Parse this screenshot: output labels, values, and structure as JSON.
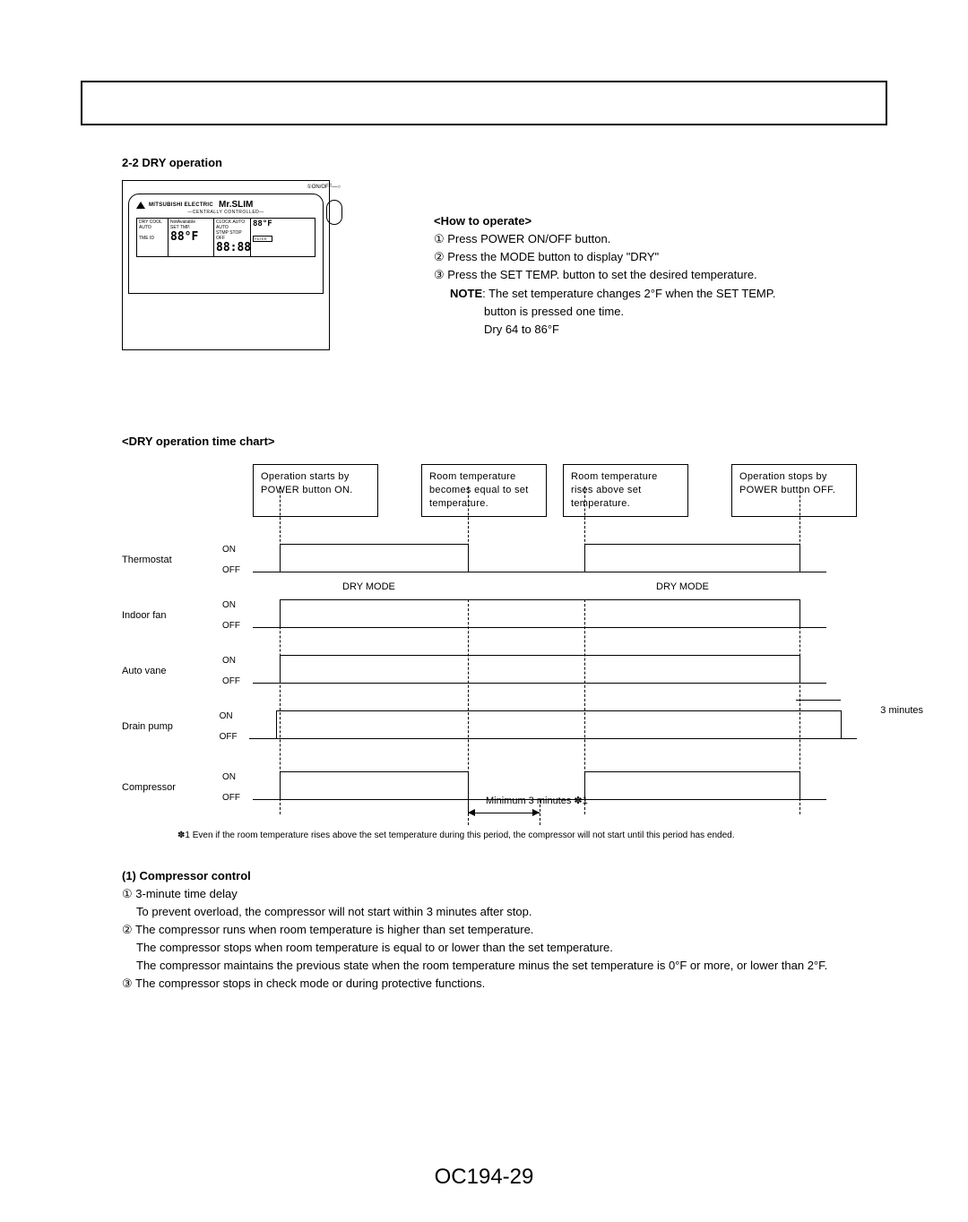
{
  "section_title": "2-2 DRY operation",
  "remote": {
    "brand_small": "MITSUBISHI ELECTRIC",
    "brand_big": "Mr.SLIM",
    "centrally": "—CENTRALLY  CONTROLLED—",
    "col1_l1": "DRY  COOL",
    "col1_l2": "AUTO",
    "col1_l3": "TME ID",
    "col1_temp": "88°F",
    "col2_l1": "NotAvailable",
    "col2_l2": "SET TMP.",
    "col2_time": "88:88",
    "col3_l1": "CLOCK AUTO  AUTO",
    "col3_l2": "STMP STOP OFF",
    "right_top": "88°F",
    "onoff": "①ON/OFF—○",
    "filter": "FILTER"
  },
  "howto": {
    "title": "<How to operate>",
    "l1": "① Press POWER ON/OFF button.",
    "l2": "② Press the MODE button to display \"DRY\"",
    "l3": "③ Press the SET TEMP. button to set the desired temperature.",
    "note_label": "NOTE",
    "note_body": ": The set temperature changes 2°F when the SET TEMP.",
    "note_body2": "button is pressed one time.",
    "note_body3": "Dry 64 to 86°F"
  },
  "chart_title": "<DRY operation time chart>",
  "events": {
    "e1": "Operation starts by POWER button ON.",
    "e2": "Room temperature becomes equal to set temperature.",
    "e3": "Room temperature rises above set temperature.",
    "e4": "Operation stops by POWER button OFF."
  },
  "row_labels": {
    "r1": "Thermostat",
    "r2": "Indoor fan",
    "r3": "Auto vane",
    "r4": "Drain pump",
    "r5": "Compressor"
  },
  "on": "ON",
  "off": "OFF",
  "dry_mode": "DRY MODE",
  "min3": "Minimum 3 minutes ✽1",
  "tag3min": "3 minutes",
  "footnote": "✽1 Even if the room temperature rises above the set temperature during this period, the compressor will not start until this period has ended.",
  "compressor": {
    "title": "(1) Compressor control",
    "l1": "① 3-minute time delay",
    "l1b": "To prevent overload, the compressor will not start within 3 minutes after stop.",
    "l2": "② The compressor runs when room temperature is higher than set temperature.",
    "l2b": "The compressor stops when room temperature is equal to or lower than the set temperature.",
    "l2c": "The compressor maintains the previous state when the room temperature minus the set temperature is 0°F or more, or lower than 2°F.",
    "l3": "③ The compressor stops in check mode or during protective functions."
  },
  "page_number": "OC194-29",
  "chart_data": {
    "type": "timing",
    "x_events": [
      "POWER ON",
      "Room temp == set temp",
      "Room temp > set temp",
      "POWER OFF"
    ],
    "series": [
      {
        "name": "Thermostat",
        "segments": [
          [
            "e1",
            "e2",
            "ON"
          ],
          [
            "e2",
            "e3",
            "OFF"
          ],
          [
            "e3",
            "e4",
            "ON"
          ]
        ]
      },
      {
        "name": "Indoor fan",
        "segments": [
          [
            "e1",
            "e4",
            "ON (DRY MODE)"
          ]
        ],
        "mode_labels": [
          [
            "e1",
            "e2",
            "DRY MODE"
          ],
          [
            "e3",
            "e4",
            "DRY MODE"
          ]
        ]
      },
      {
        "name": "Auto vane",
        "segments": [
          [
            "e1",
            "e4",
            "ON"
          ]
        ]
      },
      {
        "name": "Drain pump",
        "segments": [
          [
            "e1",
            "e4+3min",
            "ON"
          ]
        ],
        "tail_label": "3 minutes"
      },
      {
        "name": "Compressor",
        "segments": [
          [
            "e1",
            "e2",
            "ON"
          ],
          [
            "e2",
            "e2+3min",
            "OFF (min 3 min)"
          ],
          [
            "e3",
            "e4",
            "ON"
          ]
        ],
        "min_off_label": "Minimum 3 minutes ✽1"
      }
    ]
  }
}
